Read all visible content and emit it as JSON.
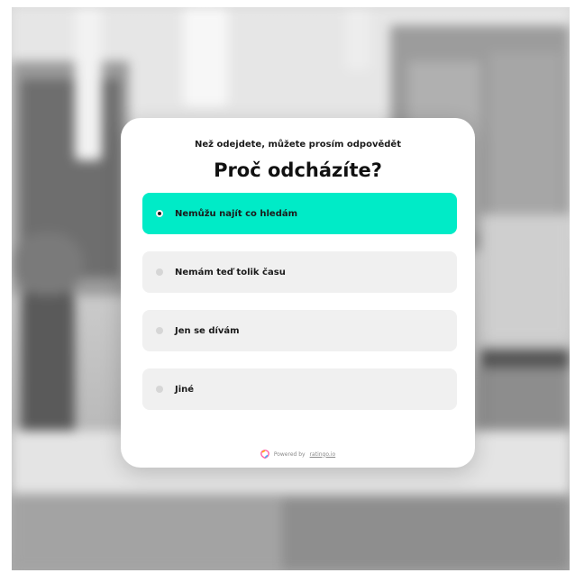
{
  "survey": {
    "subtitle": "Než odejdete, můžete prosím odpovědět",
    "title": "Proč odcházíte?",
    "options": [
      {
        "label": "Nemůžu najít co hledám",
        "selected": true
      },
      {
        "label": "Nemám teď tolik času",
        "selected": false
      },
      {
        "label": "Jen se dívám",
        "selected": false
      },
      {
        "label": "Jiné",
        "selected": false
      }
    ]
  },
  "footer": {
    "powered_prefix": "Powered by",
    "brand": "ratingo.io"
  },
  "colors": {
    "accent": "#00ebc7",
    "option_bg": "#f0f0f0",
    "modal_bg": "#ffffff"
  },
  "icons": {
    "brand_logo": "ratingo-logo-icon",
    "radio": "radio-dot-icon"
  }
}
